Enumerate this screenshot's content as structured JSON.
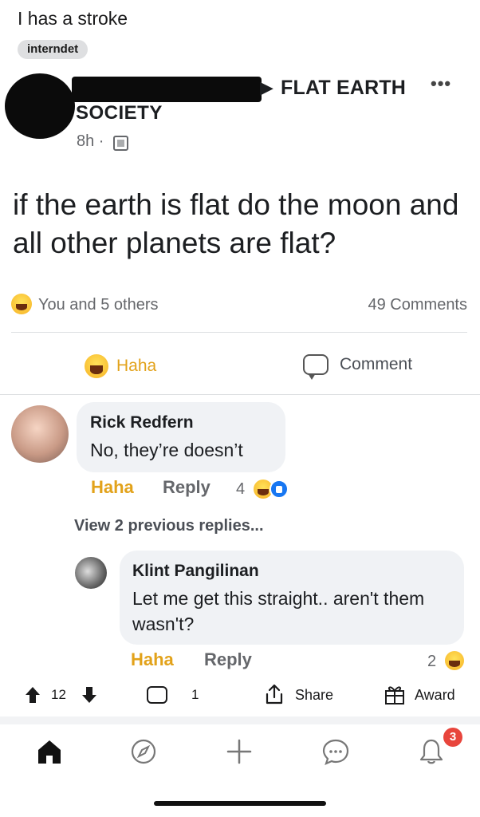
{
  "post": {
    "title": "I has a stroke",
    "flair": "interndet"
  },
  "screenshot": {
    "group_arrow": "▶",
    "group_name_line1": "FLAT EARTH",
    "group_name_line2": "SOCIETY",
    "more": "•••",
    "time": "8h ·",
    "body": "if the earth is flat do the moon and all other planets are flat?",
    "reactions_text": "You and 5 others",
    "comments_count": "49 Comments",
    "action_haha": "Haha",
    "action_comment": "Comment",
    "comments": [
      {
        "name": "Rick Redfern",
        "text": "No, they’re doesn’t",
        "haha": "Haha",
        "reply": "Reply",
        "reaction_count": "4"
      },
      {
        "name": "Klint Pangilinan",
        "text": "Let me get this straight.. aren't them wasn't?",
        "haha": "Haha",
        "reply": "Reply",
        "reaction_count": "2"
      }
    ],
    "view_previous": "View 2 previous replies..."
  },
  "action_bar": {
    "score": "12",
    "comment_count": "1",
    "share": "Share",
    "award": "Award"
  },
  "bottom_nav": {
    "items": [
      "home-icon",
      "explore-icon",
      "add-icon",
      "chat-icon",
      "notifications-icon"
    ],
    "notification_badge": "3"
  },
  "colors": {
    "haha": "#e2a21a",
    "facebook_blue": "#1877f2",
    "badge_red": "#e8453c",
    "secondary_text": "#65676b"
  }
}
